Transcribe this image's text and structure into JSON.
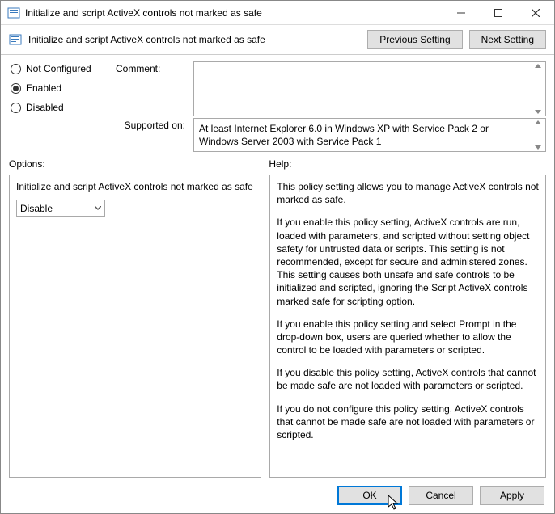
{
  "titlebar": {
    "title": "Initialize and script ActiveX controls not marked as safe"
  },
  "header": {
    "title": "Initialize and script ActiveX controls not marked as safe",
    "prev_button": "Previous Setting",
    "next_button": "Next Setting"
  },
  "config": {
    "not_configured": "Not Configured",
    "enabled": "Enabled",
    "disabled": "Disabled",
    "comment_label": "Comment:",
    "supported_label": "Supported on:",
    "supported_text": "At least Internet Explorer 6.0 in Windows XP with Service Pack 2 or Windows Server 2003 with Service Pack 1"
  },
  "split": {
    "options_label": "Options:",
    "help_label": "Help:"
  },
  "options": {
    "text": "Initialize and script ActiveX controls not marked as safe",
    "select_value": "Disable"
  },
  "help": {
    "p1": "This policy setting allows you to manage ActiveX controls not marked as safe.",
    "p2": "If you enable this policy setting, ActiveX controls are run, loaded with parameters, and scripted without setting object safety for untrusted data or scripts. This setting is not recommended, except for secure and administered zones. This setting causes both unsafe and safe controls to be initialized and scripted, ignoring the Script ActiveX controls marked safe for scripting option.",
    "p3": "If you enable this policy setting and select Prompt in the drop-down box, users are queried whether to allow the control to be loaded with parameters or scripted.",
    "p4": "If you disable this policy setting, ActiveX controls that cannot be made safe are not loaded with parameters or scripted.",
    "p5": "If you do not configure this policy setting, ActiveX controls that cannot be made safe are not loaded with parameters or scripted."
  },
  "actions": {
    "ok": "OK",
    "cancel": "Cancel",
    "apply": "Apply"
  }
}
